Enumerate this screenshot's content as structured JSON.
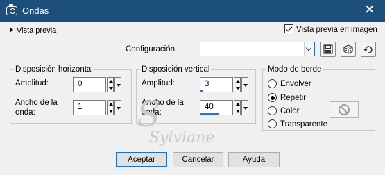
{
  "window": {
    "title": "Ondas",
    "close_glyph": "✕",
    "icon": "camera-icon"
  },
  "preview": {
    "toggle_label": "Vista previa",
    "image_preview_label": "Vista previa en imagen",
    "image_preview_checked": true
  },
  "config": {
    "label": "Configuración",
    "value": "",
    "buttons": [
      "save-preset-icon",
      "randomize-icon",
      "reset-icon"
    ]
  },
  "horizontal": {
    "title": "Disposición horizontal",
    "amplitude_label": "Amplitud:",
    "amplitude_value": "0",
    "wavelength_label_1": "Ancho de la",
    "wavelength_label_2": "onda:",
    "wavelength_value": "1"
  },
  "vertical": {
    "title": "Disposición vertical",
    "amplitude_label": "Amplitud:",
    "amplitude_value": "3",
    "wavelength_label_1": "Ancho de la",
    "wavelength_label_2": "onda:",
    "wavelength_value": "40"
  },
  "edge": {
    "title": "Modo de borde",
    "options": [
      {
        "label": "Envolver",
        "selected": false
      },
      {
        "label": "Repetir",
        "selected": true
      },
      {
        "label": "Color",
        "selected": false
      },
      {
        "label": "Transparente",
        "selected": false
      }
    ]
  },
  "watermark": {
    "text": "Sylviane"
  },
  "footer": {
    "ok": "Aceptar",
    "cancel": "Cancelar",
    "help": "Ayuda"
  },
  "colors": {
    "titlebar": "#1d4f7c",
    "focus": "#2d6ed1"
  }
}
